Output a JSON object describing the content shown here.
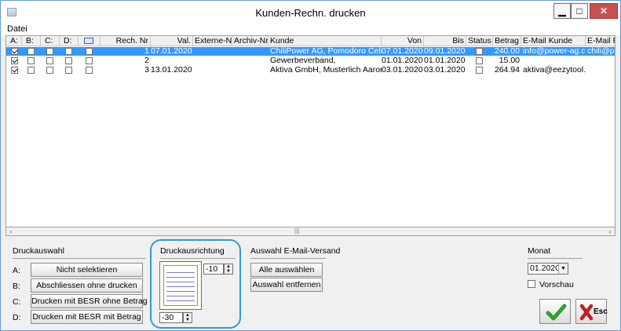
{
  "window": {
    "title": "Kunden-Rechn. drucken"
  },
  "menu": {
    "datei": "Datei"
  },
  "grid": {
    "headers": [
      "A:",
      "B:",
      "C:",
      "D:",
      "",
      "Rech. Nr",
      "Val.",
      "Externe-Nr",
      "Archiv-Nr",
      "Kunde",
      "Von",
      "Bis",
      "Status",
      "Betrag",
      "E-Mail Kunde",
      "E-Mail R"
    ],
    "rows": [
      {
        "a": true,
        "b": false,
        "c": false,
        "d": false,
        "e": false,
        "nr": "1",
        "val": "07.01.2020",
        "ext": "",
        "arch": "",
        "kunde": "ChiliPower AG, Pomodoro Celina",
        "von": "07.01.2020",
        "bis": "09.01.2020",
        "status": false,
        "betrag": "240.00",
        "email": "info@power-ag.ch",
        "email_r": "chili@po",
        "selected": true
      },
      {
        "a": true,
        "b": false,
        "c": false,
        "d": false,
        "e": false,
        "nr": "2",
        "val": "",
        "ext": "",
        "arch": "",
        "kunde": "Gewerbeverband,",
        "von": "01.01.2020",
        "bis": "01.01.2020",
        "status": false,
        "betrag": "15.00",
        "email": "",
        "email_r": "",
        "selected": false
      },
      {
        "a": true,
        "b": false,
        "c": false,
        "d": false,
        "e": false,
        "nr": "3",
        "val": "13.01.2020",
        "ext": "",
        "arch": "",
        "kunde": "Aktiva GmbH, Musterlich Aaron",
        "von": "03.01.2020",
        "bis": "03.01.2020",
        "status": false,
        "betrag": "264.94",
        "email": "aktiva@eezytool.ch",
        "email_r": "",
        "selected": false
      }
    ]
  },
  "druckauswahl": {
    "title": "Druckauswahl",
    "items": [
      {
        "key": "A:",
        "label": "Nicht selektieren"
      },
      {
        "key": "B:",
        "label": "Abschliessen ohne drucken"
      },
      {
        "key": "C:",
        "label": "Drucken mit BESR ohne Betrag"
      },
      {
        "key": "D:",
        "label": "Drucken mit BESR mit Betrag"
      }
    ]
  },
  "druckausrichtung": {
    "title": "Druckausrichtung",
    "horizontal": "-10",
    "vertical": "-30"
  },
  "email_versand": {
    "title": "Auswahl E-Mail-Versand",
    "select_all": "Alle auswählen",
    "remove": "Auswahl entfernen"
  },
  "monat": {
    "title": "Monat",
    "value": "01.2020",
    "vorschau": "Vorschau",
    "vorschau_checked": false
  },
  "actions": {
    "ok_icon": "checkmark-icon",
    "esc_label": "Esc",
    "esc_icon": "cross-icon"
  },
  "colors": {
    "selection": "#3399ff",
    "highlight_border": "#3399cc",
    "ok_green": "#2e9e2e",
    "esc_red": "#c02020"
  }
}
